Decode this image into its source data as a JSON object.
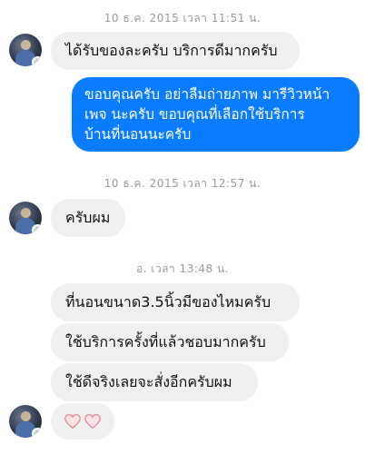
{
  "timestamps": [
    "10 ธ.ค. 2015 เวลา 11:51 น.",
    "10 ธ.ค. 2015 เวลา 12:57 น.",
    "อ. เวลา 13:48 น."
  ],
  "messages": [
    {
      "from": "them",
      "text": "ได้รับของละครับ บริการดีมากครับ"
    },
    {
      "from": "me",
      "lines": [
        "ขอบคุณครับ อย่าลืมถ่ายภาพ มารีวิวหน้า",
        "เพจ นะครับ  ขอบคุณที่เลือกใช้บริการ",
        "บ้านที่นอนนะครับ"
      ]
    },
    {
      "from": "them",
      "text": "ครับผม"
    },
    {
      "from": "them",
      "text": "ที่นอนขนาด3.5นิ้วมีของไหมครับ"
    },
    {
      "from": "them",
      "text": "ใช้บริการครั้งที่แล้วชอบมากครับ"
    },
    {
      "from": "them",
      "text": "ใช้ดีจริงเลยจะสั่งอีกครับผม"
    },
    {
      "from": "them",
      "emoji": "two-hearts"
    }
  ],
  "colors": {
    "outgoing": "#0a7cff",
    "incoming": "#f1f0f0",
    "heart_fill": "#ffe3e6",
    "heart_stroke": "#e07a86"
  }
}
